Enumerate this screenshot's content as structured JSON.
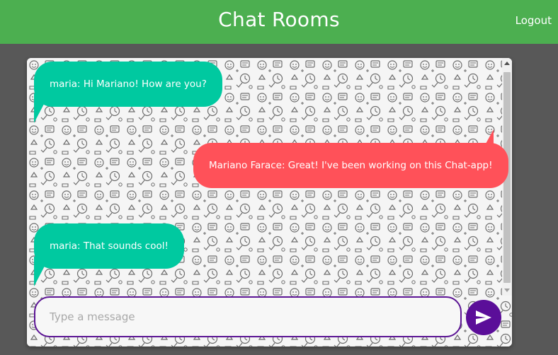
{
  "header": {
    "title": "Chat Rooms",
    "logout_label": "Logout"
  },
  "messages": [
    {
      "sender": "maria",
      "text": "maria: Hi Mariano! How are you?",
      "side": "left"
    },
    {
      "sender": "Mariano Farace",
      "text": "Mariano Farace: Great! I've been working on this Chat-app!",
      "side": "right"
    },
    {
      "sender": "maria",
      "text": "maria: That sounds cool!",
      "side": "left"
    }
  ],
  "composer": {
    "placeholder": "Type a message",
    "value": "",
    "send_icon": "send-icon"
  },
  "colors": {
    "header_bg": "#4caf50",
    "incoming_bubble": "#00c9a0",
    "outgoing_bubble": "#ff5159",
    "accent": "#5b0e99",
    "page_bg": "#585858"
  }
}
